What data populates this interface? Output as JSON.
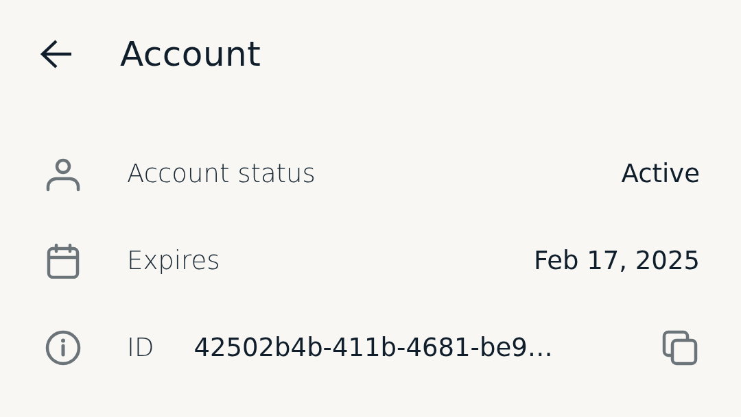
{
  "header": {
    "title": "Account"
  },
  "rows": [
    {
      "kind": "status",
      "label": "Account status",
      "value": "Active"
    },
    {
      "kind": "date",
      "label": "Expires",
      "value": "Feb 17, 2025"
    },
    {
      "kind": "identifier",
      "label": "ID",
      "value": "42502b4b-411b-4681-be9…"
    }
  ]
}
